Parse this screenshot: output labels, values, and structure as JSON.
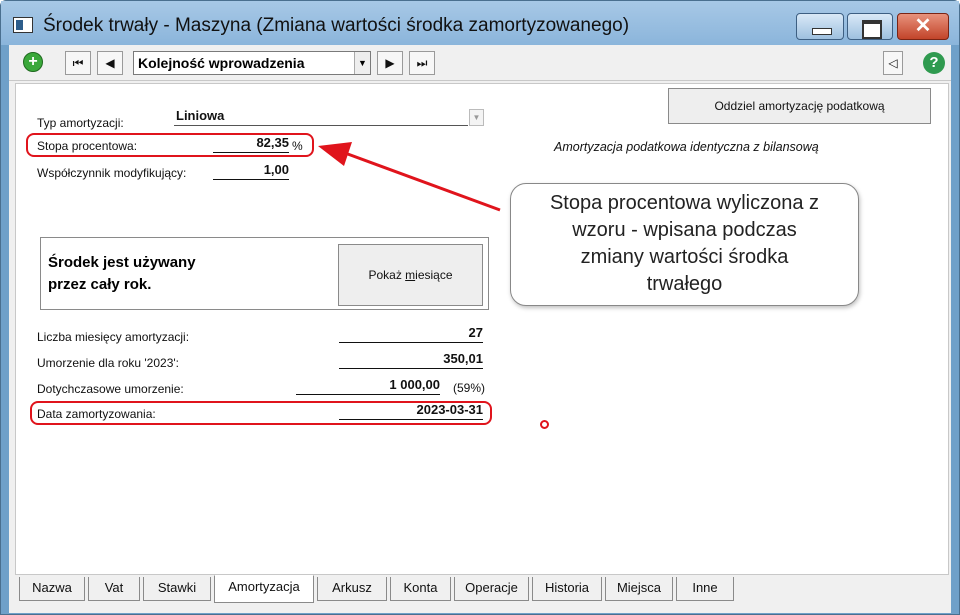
{
  "window": {
    "title": "Środek trwały - Maszyna (Zmiana wartości środka zamortyzowanego)",
    "min_glyph": "",
    "max_glyph": "",
    "close_glyph": "✕"
  },
  "toolbar": {
    "add_glyph": "+",
    "first_glyph": "⏮",
    "prev_glyph": "◀",
    "order_value": "Kolejność wprowadzenia",
    "combo_arrow": "▼",
    "next_glyph": "▶",
    "last_glyph": "⏭",
    "collapse_glyph": "◁",
    "help_glyph": "?"
  },
  "form": {
    "typ_label": "Typ amortyzacji:",
    "typ_value": "Liniowa",
    "stopa_label": "Stopa procentowa:",
    "stopa_value": "82,35",
    "stopa_unit": "%",
    "wsp_label": "Współczynnik modyfikujący:",
    "wsp_value": "1,00",
    "tax_button": "Oddziel amortyzację podatkową",
    "tax_note": "Amortyzacja podatkowa identyczna z bilansową",
    "usage_text_1": "Środek jest używany",
    "usage_text_2": "przez cały rok.",
    "months_button_pre": "Pokaż ",
    "months_button_ul": "m",
    "months_button_post": "iesiące",
    "liczba_label": "Liczba miesięcy amortyzacji:",
    "liczba_value": "27",
    "umorzenie_label": "Umorzenie dla roku '2023':",
    "umorzenie_value": "350,01",
    "dotych_label": "Dotychczasowe umorzenie:",
    "dotych_value": "1 000,00",
    "dotych_pct": "(59%)",
    "data_label": "Data zamortyzowania:",
    "data_value": "2023-03-31"
  },
  "callout": {
    "line1": "Stopa procentowa wyliczona z",
    "line2": "wzoru - wpisana podczas",
    "line3": "zmiany wartości środka",
    "line4": "trwałego"
  },
  "tabs": [
    "Nazwa",
    "Vat",
    "Stawki",
    "Amortyzacja",
    "Arkusz",
    "Konta",
    "Operacje",
    "Historia",
    "Miejsca",
    "Inne"
  ],
  "active_tab": "Amortyzacja",
  "colors": {
    "highlight": "#e0141c",
    "arrow": "#e0141c"
  }
}
